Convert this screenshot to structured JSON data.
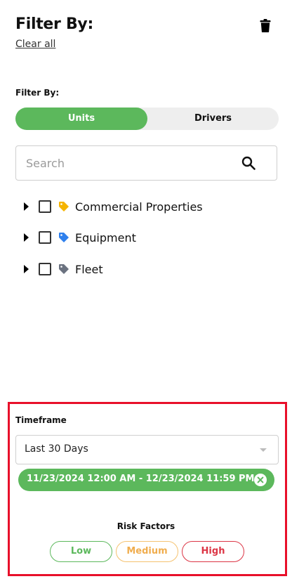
{
  "header": {
    "title": "Filter By:",
    "clear_all": "Clear all",
    "delete_icon": "trash-icon"
  },
  "filter": {
    "label": "Filter By:",
    "tabs": [
      {
        "label": "Units",
        "active": true
      },
      {
        "label": "Drivers",
        "active": false
      }
    ]
  },
  "search": {
    "placeholder": "Search",
    "value": "",
    "icon": "search-icon"
  },
  "tree": [
    {
      "label": "Commercial Properties",
      "tag_color": "#f5b400",
      "checked": false
    },
    {
      "label": "Equipment",
      "tag_color": "#2f80ed",
      "checked": false
    },
    {
      "label": "Fleet",
      "tag_color": "#6b7280",
      "checked": false
    }
  ],
  "timeframe": {
    "label": "Timeframe",
    "selected": "Last 30 Days",
    "range_chip": "11/23/2024 12:00 AM - 12/23/2024 11:59 PM"
  },
  "risk": {
    "label": "Risk Factors",
    "options": [
      {
        "label": "Low",
        "color": "#5cb85c"
      },
      {
        "label": "Medium",
        "color": "#f0ad4e"
      },
      {
        "label": "High",
        "color": "#dc3545"
      }
    ]
  },
  "colors": {
    "accent": "#5cb85c",
    "highlight_border": "#e8102a"
  }
}
